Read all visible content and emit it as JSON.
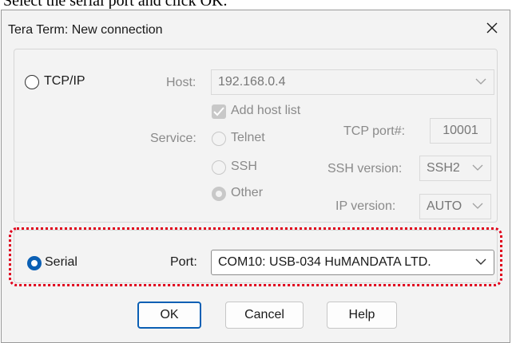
{
  "caption": "Select the serial port and click OK.",
  "window": {
    "title": "Tera Term: New connection"
  },
  "tcpip": {
    "label": "TCP/IP",
    "host_label": "Host:",
    "host_value": "192.168.0.4",
    "add_host_list": "Add host list",
    "service_label": "Service:",
    "telnet": "Telnet",
    "ssh": "SSH",
    "other": "Other",
    "tcp_port_label": "TCP port#:",
    "tcp_port_value": "10001",
    "ssh_version_label": "SSH version:",
    "ssh_version_value": "SSH2",
    "ip_version_label": "IP version:",
    "ip_version_value": "AUTO"
  },
  "serial": {
    "label": "Serial",
    "port_label": "Port:",
    "port_value": "COM10: USB-034 HuMANDATA LTD."
  },
  "buttons": {
    "ok": "OK",
    "cancel": "Cancel",
    "help": "Help"
  },
  "colors": {
    "accent": "#0a5fb4",
    "highlight_border": "#e0001b"
  }
}
